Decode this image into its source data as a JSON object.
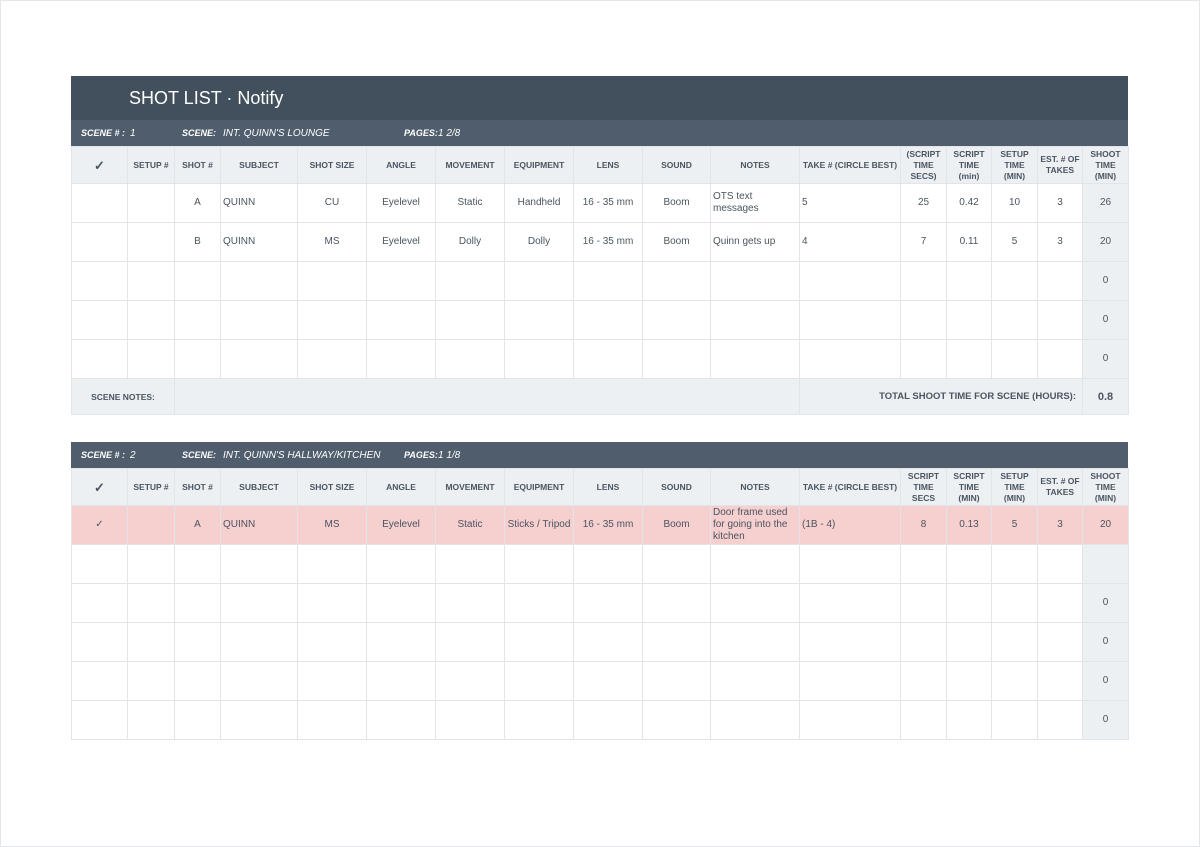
{
  "title": "SHOT LIST · Notify",
  "labels": {
    "scene_no": "SCENE # :",
    "scene": "SCENE:",
    "pages": "PAGES:",
    "scene_notes": "SCENE NOTES:",
    "total_shoot": "TOTAL SHOOT TIME FOR SCENE (HOURS):"
  },
  "columns": {
    "check": "✓",
    "setup": "SETUP #",
    "shot": "SHOT #",
    "subject": "SUBJECT",
    "shot_size": "SHOT SIZE",
    "angle": "ANGLE",
    "movement": "MOVEMENT",
    "equipment": "EQUIPMENT",
    "lens": "LENS",
    "sound": "SOUND",
    "notes": "NOTES",
    "take": "TAKE # (CIRCLE BEST)",
    "script_secs_1": "(SCRIPT TIME SECS)",
    "script_secs_2": "SCRIPT TIME SECS",
    "script_min": "SCRIPT TIME (min)",
    "script_min_2": "SCRIPT TIME (MIN)",
    "setup_time": "SETUP TIME (MIN)",
    "takes": "EST. # OF TAKES",
    "shoot": "SHOOT TIME (MIN)"
  },
  "scenes": [
    {
      "number": "1",
      "name": "INT. QUINN'S LOUNGE",
      "pages": "1 2/8",
      "rows": [
        {
          "check": "",
          "setup": "",
          "shot": "A",
          "subject": "QUINN",
          "size": "CU",
          "angle": "Eyelevel",
          "movement": "Static",
          "equipment": "Handheld",
          "lens": "16 - 35 mm",
          "sound": "Boom",
          "notes": "OTS text messages",
          "take": "5",
          "secs": "25",
          "min": "0.42",
          "setup_time": "10",
          "takes": "3",
          "shoot": "26"
        },
        {
          "check": "",
          "setup": "",
          "shot": "B",
          "subject": "QUINN",
          "size": "MS",
          "angle": "Eyelevel",
          "movement": "Dolly",
          "equipment": "Dolly",
          "lens": "16 - 35 mm",
          "sound": "Boom",
          "notes": "Quinn gets up",
          "take": "4",
          "secs": "7",
          "min": "0.11",
          "setup_time": "5",
          "takes": "3",
          "shoot": "20"
        },
        {
          "check": "",
          "setup": "",
          "shot": "",
          "subject": "",
          "size": "",
          "angle": "",
          "movement": "",
          "equipment": "",
          "lens": "",
          "sound": "",
          "notes": "",
          "take": "",
          "secs": "",
          "min": "",
          "setup_time": "",
          "takes": "",
          "shoot": "0"
        },
        {
          "check": "",
          "setup": "",
          "shot": "",
          "subject": "",
          "size": "",
          "angle": "",
          "movement": "",
          "equipment": "",
          "lens": "",
          "sound": "",
          "notes": "",
          "take": "",
          "secs": "",
          "min": "",
          "setup_time": "",
          "takes": "",
          "shoot": "0"
        },
        {
          "check": "",
          "setup": "",
          "shot": "",
          "subject": "",
          "size": "",
          "angle": "",
          "movement": "",
          "equipment": "",
          "lens": "",
          "sound": "",
          "notes": "",
          "take": "",
          "secs": "",
          "min": "",
          "setup_time": "",
          "takes": "",
          "shoot": "0"
        }
      ],
      "total_hours": "0.8"
    },
    {
      "number": "2",
      "name": "INT. QUINN'S HALLWAY/KITCHEN",
      "pages": "1 1/8",
      "rows": [
        {
          "check": "✓",
          "setup": "",
          "shot": "A",
          "subject": "QUINN",
          "size": "MS",
          "angle": "Eyelevel",
          "movement": "Static",
          "equipment": "Sticks / Tripod",
          "lens": "16 - 35 mm",
          "sound": "Boom",
          "notes": "Door frame used for going into the kitchen",
          "take": "(1B - 4)",
          "secs": "8",
          "min": "0.13",
          "setup_time": "5",
          "takes": "3",
          "shoot": "20"
        },
        {
          "check": "",
          "setup": "",
          "shot": "",
          "subject": "",
          "size": "",
          "angle": "",
          "movement": "",
          "equipment": "",
          "lens": "",
          "sound": "",
          "notes": "",
          "take": "",
          "secs": "",
          "min": "",
          "setup_time": "",
          "takes": "",
          "shoot": ""
        },
        {
          "check": "",
          "setup": "",
          "shot": "",
          "subject": "",
          "size": "",
          "angle": "",
          "movement": "",
          "equipment": "",
          "lens": "",
          "sound": "",
          "notes": "",
          "take": "",
          "secs": "",
          "min": "",
          "setup_time": "",
          "takes": "",
          "shoot": "0"
        },
        {
          "check": "",
          "setup": "",
          "shot": "",
          "subject": "",
          "size": "",
          "angle": "",
          "movement": "",
          "equipment": "",
          "lens": "",
          "sound": "",
          "notes": "",
          "take": "",
          "secs": "",
          "min": "",
          "setup_time": "",
          "takes": "",
          "shoot": "0"
        },
        {
          "check": "",
          "setup": "",
          "shot": "",
          "subject": "",
          "size": "",
          "angle": "",
          "movement": "",
          "equipment": "",
          "lens": "",
          "sound": "",
          "notes": "",
          "take": "",
          "secs": "",
          "min": "",
          "setup_time": "",
          "takes": "",
          "shoot": "0"
        },
        {
          "check": "",
          "setup": "",
          "shot": "",
          "subject": "",
          "size": "",
          "angle": "",
          "movement": "",
          "equipment": "",
          "lens": "",
          "sound": "",
          "notes": "",
          "take": "",
          "secs": "",
          "min": "",
          "setup_time": "",
          "takes": "",
          "shoot": "0"
        }
      ]
    }
  ],
  "colors": {
    "title_bar": "#424f5c",
    "scene_bar": "#4f5d6c",
    "header_bg": "#edf0f3",
    "highlight_row": "#f6cfcf"
  }
}
